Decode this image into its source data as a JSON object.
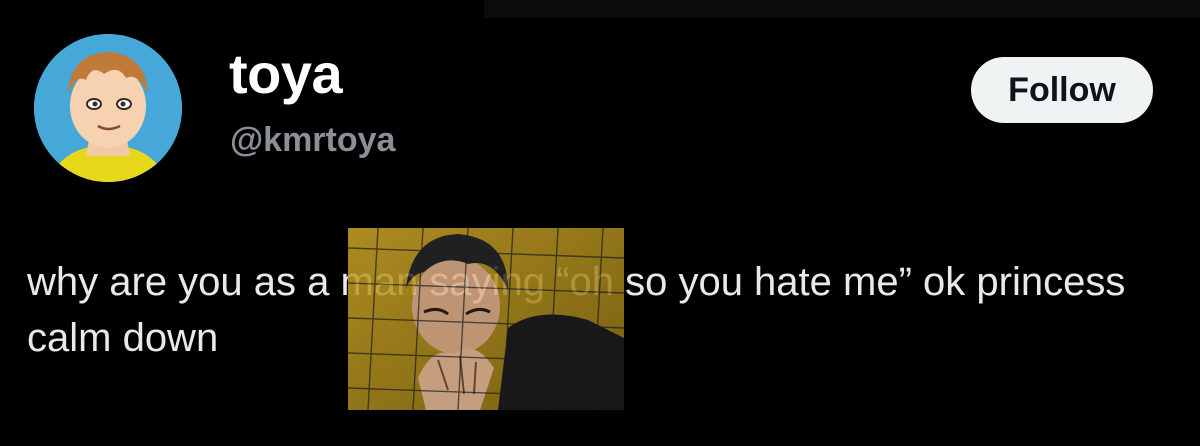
{
  "profile": {
    "display_name": "toya",
    "handle": "@kmrtoya",
    "avatar_icon": "anime-character-avatar-icon"
  },
  "actions": {
    "follow_label": "Follow"
  },
  "tweet": {
    "text": "why are you as a man saying “oh so you hate me” ok princess calm down",
    "image_icon": "anime-character-pose-image"
  },
  "colors": {
    "background": "#000000",
    "text": "#e7e9ea",
    "handle": "#8b9096",
    "follow_bg": "#eff3f4",
    "avatar_bg": "#46a8d8",
    "image_gold": "#c9a326"
  }
}
